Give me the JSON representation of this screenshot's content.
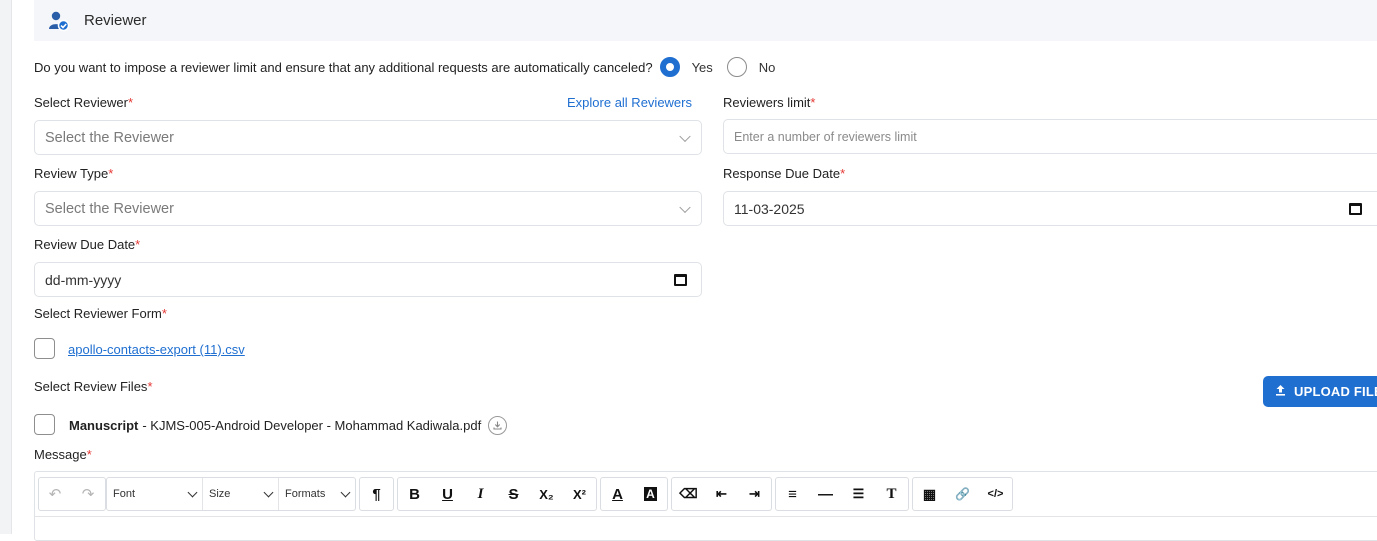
{
  "header": {
    "title": "Reviewer",
    "icon": "reviewer-icon"
  },
  "question": {
    "text": "Do you want to impose a reviewer limit and ensure that any additional requests are automatically canceled?",
    "options": [
      "Yes",
      "No"
    ],
    "selected": "Yes"
  },
  "select_reviewer": {
    "label": "Select Reviewer",
    "explore_link": "Explore all Reviewers",
    "placeholder": "Select the Reviewer"
  },
  "reviewers_limit": {
    "label": "Reviewers limit",
    "placeholder": "Enter a number of reviewers limit"
  },
  "review_type": {
    "label": "Review Type",
    "placeholder": "Select the Reviewer"
  },
  "response_due_date": {
    "label": "Response Due Date",
    "value": "11-03-2025"
  },
  "review_due_date": {
    "label": "Review Due Date",
    "placeholder": "dd-mm-yyyy"
  },
  "reviewer_form": {
    "label": "Select Reviewer Form",
    "file": "apollo-contacts-export (11).csv"
  },
  "review_files": {
    "label": "Select Review Files",
    "upload_button": "UPLOAD FILE",
    "file_type": "Manuscript",
    "file_name": " - KJMS-005-Android Developer - Mohammad Kadiwala.pdf"
  },
  "message": {
    "label": "Message",
    "toolbar": {
      "font": "Font",
      "size": "Size",
      "formats": "Formats",
      "buttons": [
        "¶",
        "B",
        "U",
        "I",
        "S",
        "X₂",
        "X²",
        "A",
        "A",
        "⌫",
        "⇤",
        "⇥",
        "≡",
        "—",
        "☰",
        "T",
        "▦",
        "🔗",
        "</>"
      ]
    }
  },
  "colors": {
    "accent": "#1f6fd1",
    "required": "#e53935",
    "header_bg": "#f4f6f9"
  }
}
